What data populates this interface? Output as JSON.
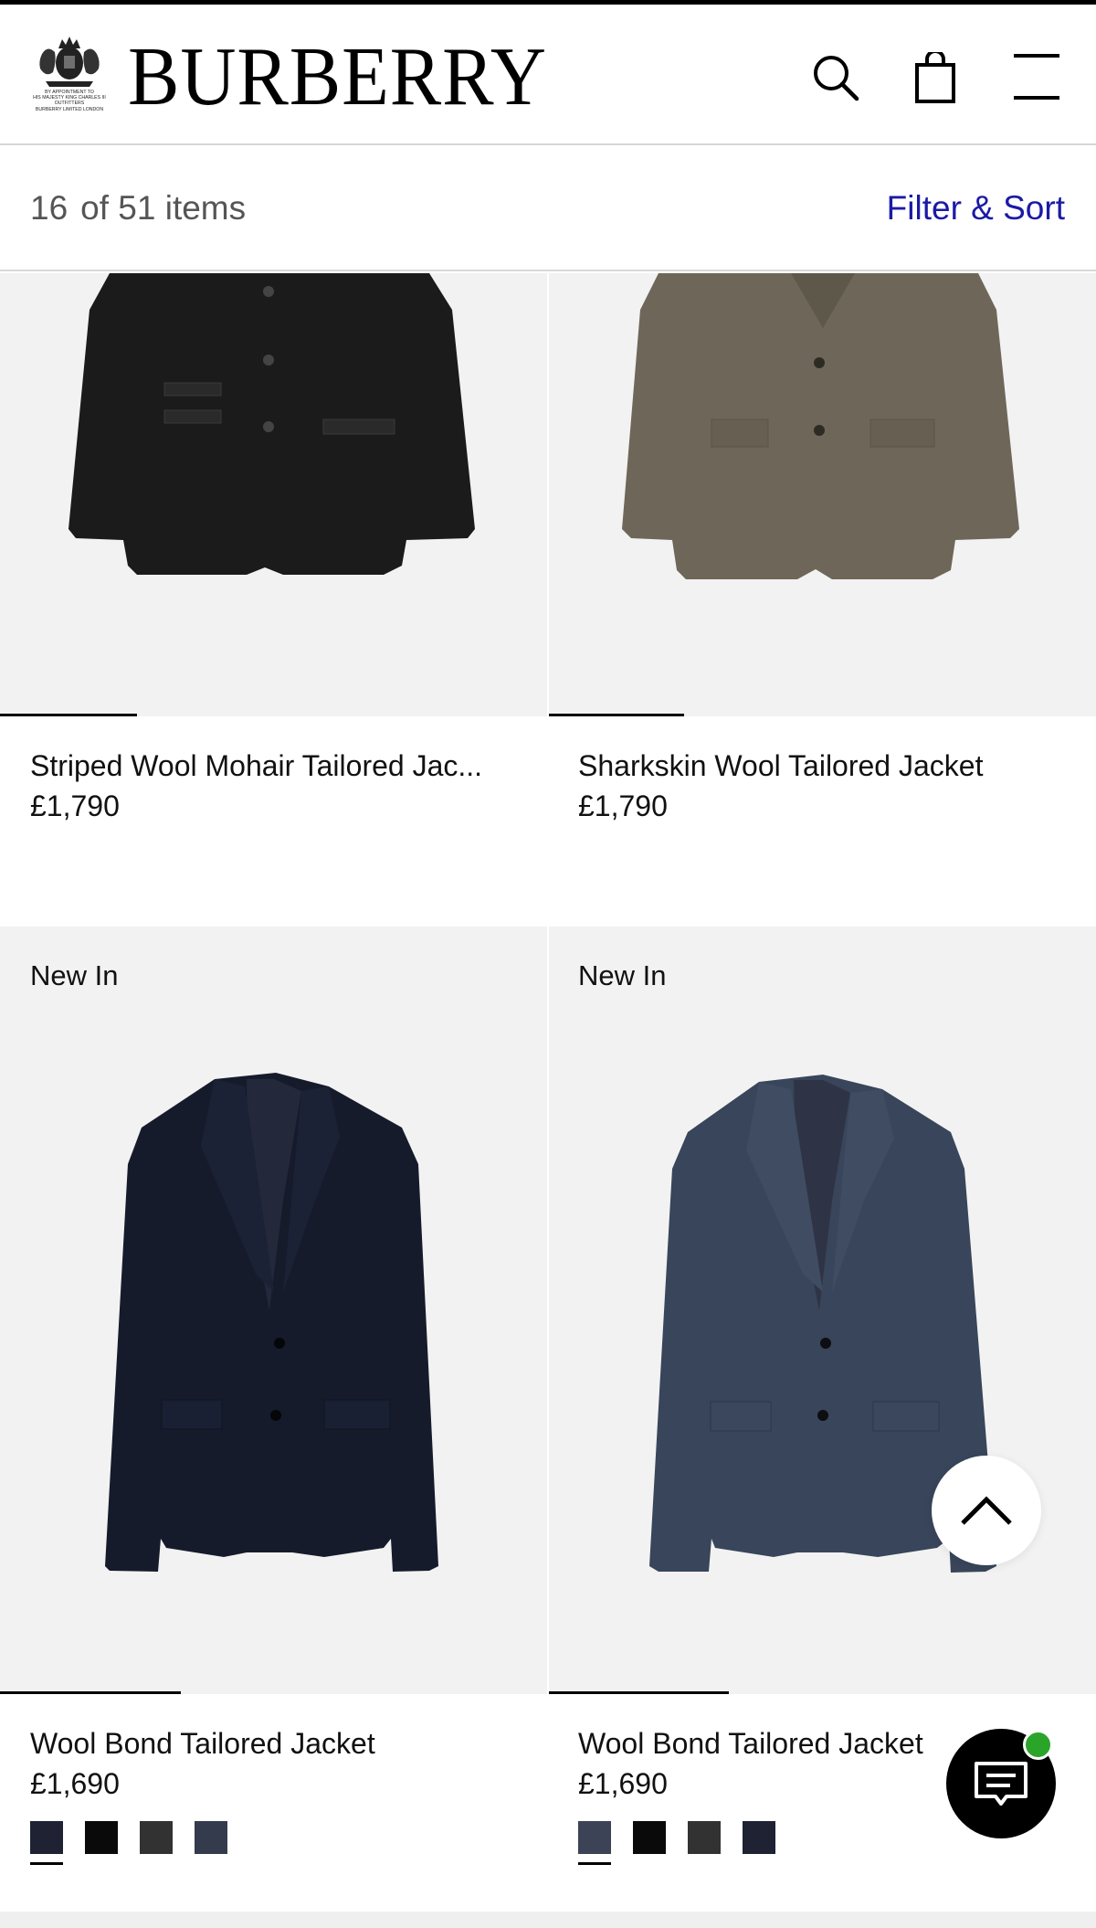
{
  "header": {
    "brand": "BURBERRY",
    "royal_warrant": "BY APPOINTMENT TO\nHIS MAJESTY KING CHARLES III\nOUTFITTERS\nBURBERRY LIMITED LONDON",
    "icons": [
      "search-icon",
      "shopping-bag-icon",
      "menu-icon"
    ]
  },
  "results": {
    "shown": "16",
    "total_text": "of 51 items",
    "filter_sort": "Filter & Sort"
  },
  "products": [
    {
      "name": "Striped Wool Mohair Tailored Jac...",
      "price": "£1,790",
      "badge": "",
      "jacket_color": "#1b1b1b"
    },
    {
      "name": "Sharkskin Wool Tailored Jacket",
      "price": "£1,790",
      "badge": "",
      "jacket_color": "#6e6759"
    },
    {
      "name": "Wool Bond Tailored Jacket",
      "price": "£1,690",
      "badge": "New In",
      "jacket_color": "#161b2c",
      "swatches": [
        "#1e2233",
        "#0a0a0a",
        "#323232",
        "#343b4c"
      ]
    },
    {
      "name": "Wool Bond Tailored Jacket",
      "price": "£1,690",
      "badge": "New In",
      "jacket_color": "#38455a",
      "swatches": [
        "#3c4356",
        "#0a0a0a",
        "#323232",
        "#1e2233"
      ]
    }
  ],
  "colors": {
    "accent": "#1a1aa6",
    "image_bg": "#f2f2f2",
    "chat_status": "#2aa52a"
  },
  "widgets": {
    "scroll_top_icon": "chevron-up-icon",
    "chat_icon": "chat-bubble-icon"
  }
}
